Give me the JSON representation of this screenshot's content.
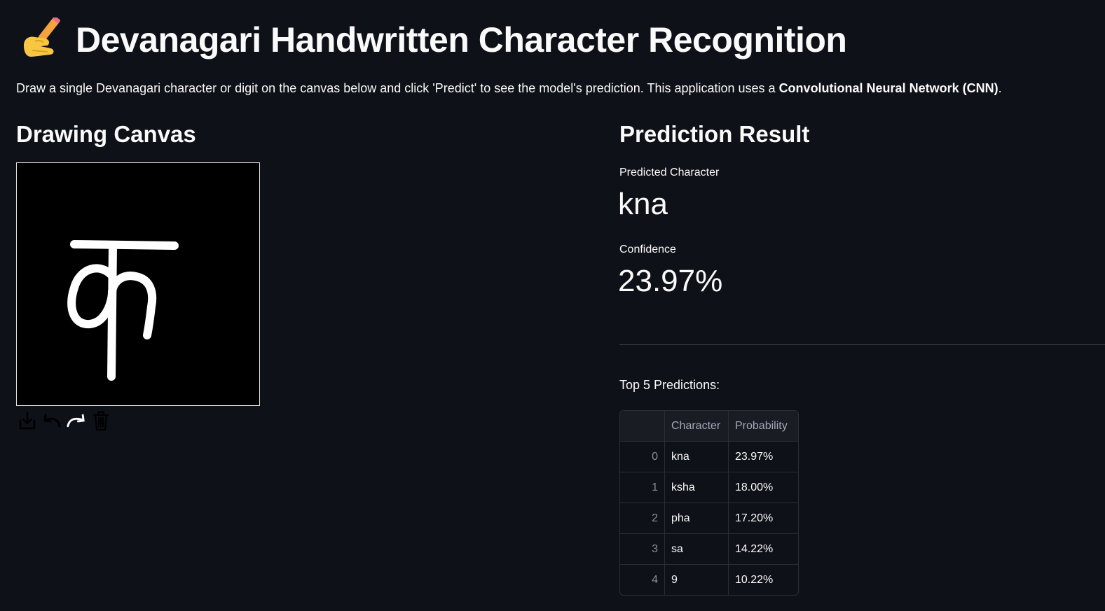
{
  "header": {
    "title": "Devanagari Handwritten Character Recognition",
    "title_icon": "writing-hand-icon",
    "intro_prefix": "Draw a single Devanagari character or digit on the canvas below and click 'Predict' to see the model's prediction. This application uses a ",
    "intro_bold": "Convolutional Neural Network (CNN)",
    "intro_suffix": "."
  },
  "canvas_section": {
    "heading": "Drawing Canvas",
    "drawn_character": "क",
    "toolbar": [
      "download-icon",
      "undo-icon",
      "redo-icon",
      "trash-icon"
    ]
  },
  "result": {
    "heading": "Prediction Result",
    "predicted_label": "Predicted Character",
    "predicted_value": "kna",
    "confidence_label": "Confidence",
    "confidence_value": "23.97%",
    "top5_title": "Top 5 Predictions:",
    "table": {
      "columns": [
        "",
        "Character",
        "Probability"
      ],
      "rows": [
        [
          "0",
          "kna",
          "23.97%"
        ],
        [
          "1",
          "ksha",
          "18.00%"
        ],
        [
          "2",
          "pha",
          "17.20%"
        ],
        [
          "3",
          "sa",
          "14.22%"
        ],
        [
          "4",
          "9",
          "10.22%"
        ]
      ]
    }
  },
  "colors": {
    "background": "#0e1117",
    "text": "#fafafa",
    "canvas": "#000000",
    "stroke": "#ffffff",
    "table_border": "#2b2e36"
  }
}
